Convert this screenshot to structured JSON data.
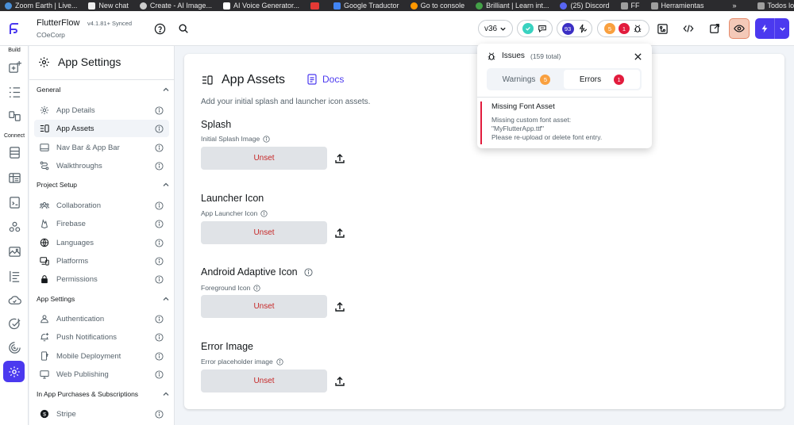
{
  "bookmarks": [
    {
      "label": "Zoom Earth | Live...",
      "color": "#4a90d9"
    },
    {
      "label": "New chat",
      "color": "#eeeeee"
    },
    {
      "label": "Create - AI Image...",
      "color": "#cccccc"
    },
    {
      "label": "AI Voice Generator...",
      "color": "#ffffff"
    },
    {
      "label": "",
      "color": "#e53935"
    },
    {
      "label": "Google Traductor",
      "color": "#4285f4"
    },
    {
      "label": "Go to console",
      "color": "#ff9800"
    },
    {
      "label": "Brilliant | Learn int...",
      "color": "#43a047"
    },
    {
      "label": "(25) Discord",
      "color": "#5865f2"
    },
    {
      "label": "FF",
      "color": "#9e9e9e"
    },
    {
      "label": "Herramientas",
      "color": "#9e9e9e"
    }
  ],
  "bookmarks_more": "»",
  "bookmarks_all": "Todos los favoritos",
  "app": {
    "name": "FlutterFlow",
    "version": "v4.1.81+",
    "sync": "Synced",
    "project": "COeCorp"
  },
  "toolbar": {
    "version_select": "v36",
    "warnings_count": "93",
    "issue_warn": "5",
    "issue_err": "1"
  },
  "rail": {
    "build": "Build",
    "connect": "Connect"
  },
  "panel": {
    "title": "App Settings",
    "sections": [
      {
        "label": "General",
        "items": [
          "App Details",
          "App Assets",
          "Nav Bar & App Bar",
          "Walkthroughs"
        ]
      },
      {
        "label": "Project Setup",
        "items": [
          "Collaboration",
          "Firebase",
          "Languages",
          "Platforms",
          "Permissions"
        ]
      },
      {
        "label": "App Settings",
        "items": [
          "Authentication",
          "Push Notifications",
          "Mobile Deployment",
          "Web Publishing"
        ]
      },
      {
        "label": "In App Purchases & Subscriptions",
        "items": [
          "Stripe"
        ]
      }
    ]
  },
  "main": {
    "title": "App Assets",
    "docs": "Docs",
    "description": "Add your initial splash and launcher icon assets.",
    "assets": [
      {
        "title": "Splash",
        "sub": "Initial Splash Image",
        "button": "Unset"
      },
      {
        "title": "Launcher Icon",
        "sub": "App Launcher Icon",
        "button": "Unset"
      },
      {
        "title": "Android Adaptive Icon",
        "sub": "Foreground Icon",
        "button": "Unset"
      },
      {
        "title": "Error Image",
        "sub": "Error placeholder image",
        "button": "Unset"
      }
    ]
  },
  "issues": {
    "title": "Issues",
    "total": "(159 total)",
    "tab_warnings": "Warnings",
    "tab_warnings_count": "5",
    "tab_errors": "Errors",
    "tab_errors_count": "1",
    "error_title": "Missing Font Asset",
    "error_body1": "Missing custom font asset:",
    "error_body2": "\"MyFlutterApp.ttf\"",
    "error_body3": "Please re-upload or delete font entry."
  },
  "colors": {
    "accent": "#4b39ef",
    "error": "#e21c3d",
    "warning": "#f9a03f",
    "success": "#39d2c0"
  }
}
